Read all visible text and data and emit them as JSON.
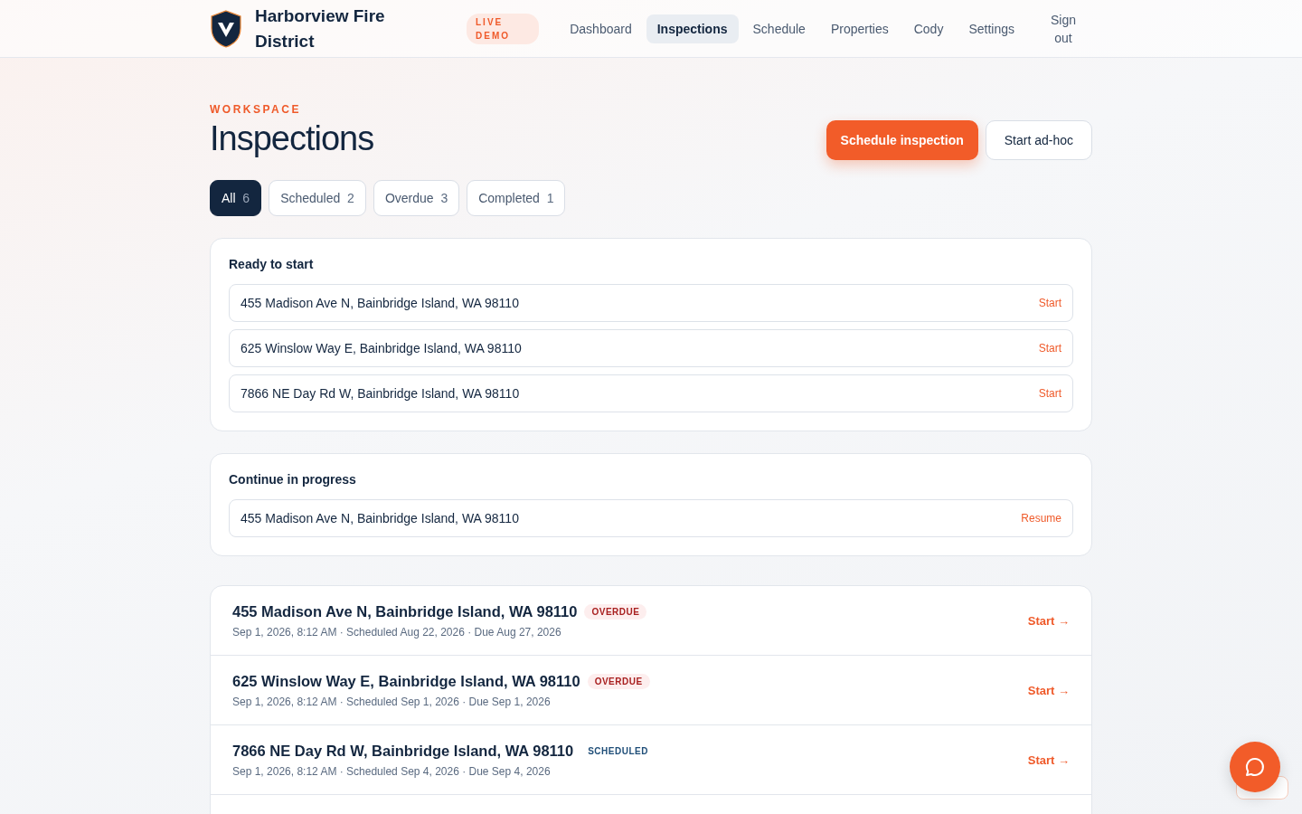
{
  "brand": {
    "name": "Harborview Fire District",
    "badge": "LIVE DEMO"
  },
  "nav": [
    {
      "label": "Dashboard",
      "selected": false
    },
    {
      "label": "Inspections",
      "selected": true
    },
    {
      "label": "Schedule",
      "selected": false
    },
    {
      "label": "Properties",
      "selected": false
    },
    {
      "label": "Cody",
      "selected": false
    },
    {
      "label": "Settings",
      "selected": false
    }
  ],
  "sign_out": "Sign out",
  "header": {
    "eyebrow": "WORKSPACE",
    "title": "Inspections",
    "primary_button": "Schedule inspection",
    "secondary_button": "Start ad-hoc"
  },
  "filters": [
    {
      "label": "All",
      "count": "6",
      "selected": true
    },
    {
      "label": "Scheduled",
      "count": "2",
      "selected": false
    },
    {
      "label": "Overdue",
      "count": "3",
      "selected": false
    },
    {
      "label": "Completed",
      "count": "1",
      "selected": false
    }
  ],
  "ready": {
    "title": "Ready to start",
    "items": [
      {
        "address": "455 Madison Ave N, Bainbridge Island, WA 98110",
        "action": "Start"
      },
      {
        "address": "625 Winslow Way E, Bainbridge Island, WA 98110",
        "action": "Start"
      },
      {
        "address": "7866 NE Day Rd W, Bainbridge Island, WA 98110",
        "action": "Start"
      }
    ]
  },
  "in_progress": {
    "title": "Continue in progress",
    "items": [
      {
        "address": "455 Madison Ave N, Bainbridge Island, WA 98110",
        "action": "Resume"
      }
    ]
  },
  "inspections": [
    {
      "address": "455 Madison Ave N, Bainbridge Island, WA 98110",
      "status": "OVERDUE",
      "kind": "overdue",
      "meta": "Sep 1, 2026, 8:12 AM · Scheduled Aug 22, 2026 · Due Aug 27, 2026",
      "action": "Start →"
    },
    {
      "address": "625 Winslow Way E, Bainbridge Island, WA 98110",
      "status": "OVERDUE",
      "kind": "overdue",
      "meta": "Sep 1, 2026, 8:12 AM · Scheduled Sep 1, 2026 · Due Sep 1, 2026",
      "action": "Start →"
    },
    {
      "address": "7866 NE Day Rd W, Bainbridge Island, WA 98110",
      "status": "SCHEDULED",
      "kind": "scheduled",
      "meta": "Sep 1, 2026, 8:12 AM · Scheduled Sep 4, 2026 · Due Sep 4, 2026",
      "action": "Start →"
    }
  ]
}
